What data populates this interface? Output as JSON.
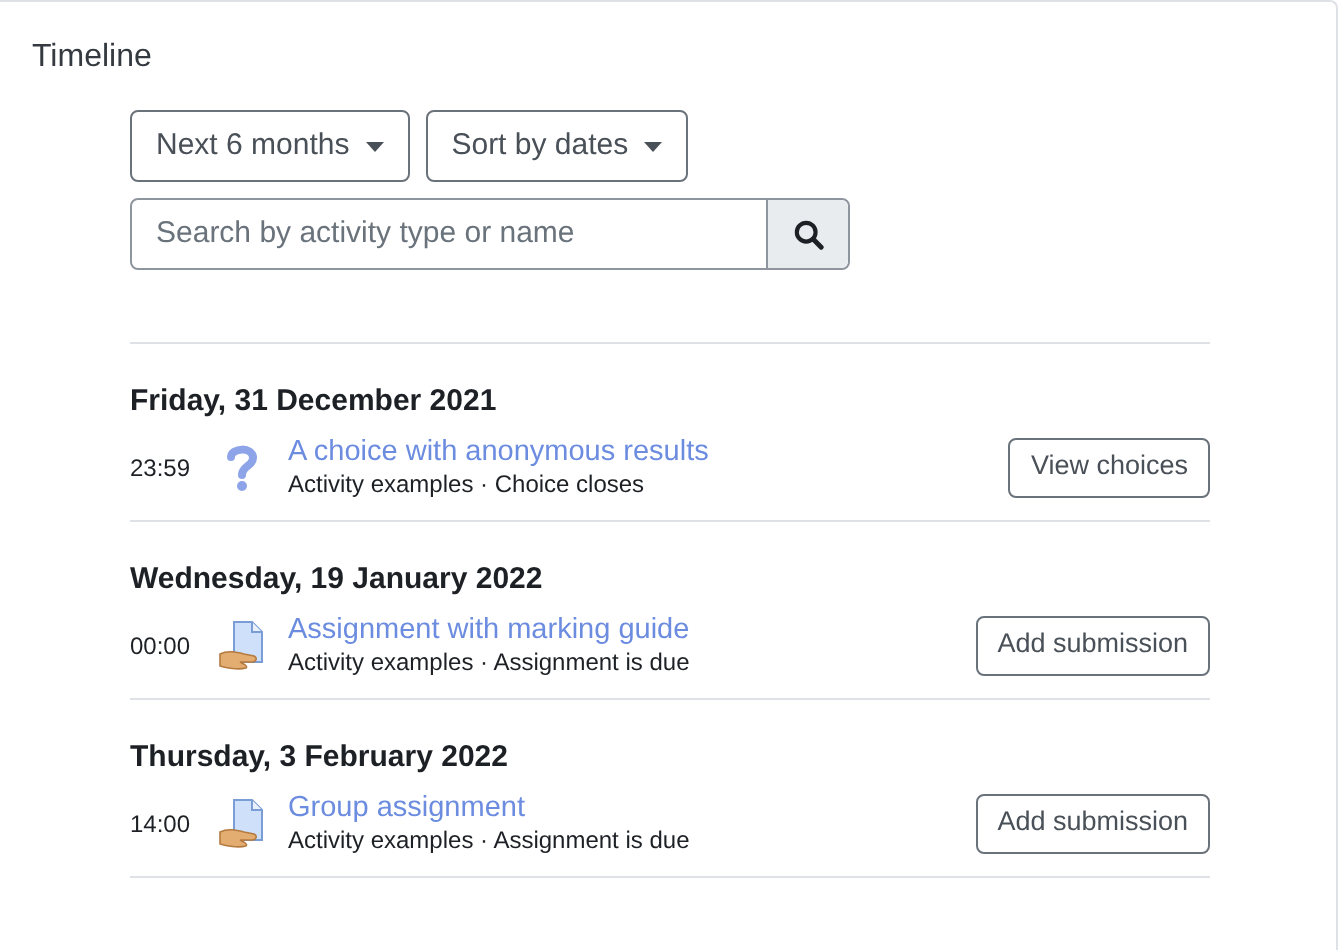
{
  "title": "Timeline",
  "filters": [
    {
      "label": "Next 6 months"
    },
    {
      "label": "Sort by dates"
    }
  ],
  "search": {
    "placeholder": "Search by activity type or name"
  },
  "days": [
    {
      "date": "Friday, 31 December 2021",
      "events": [
        {
          "time": "23:59",
          "kind": "choice",
          "name": "A choice with anonymous results",
          "details": "Activity examples · Choice closes",
          "button": "View choices"
        }
      ]
    },
    {
      "date": "Wednesday, 19 January 2022",
      "events": [
        {
          "time": "00:00",
          "kind": "assignment",
          "name": "Assignment with marking guide",
          "details": "Activity examples · Assignment is due",
          "button": "Add submission"
        }
      ]
    },
    {
      "date": "Thursday, 3 February 2022",
      "events": [
        {
          "time": "14:00",
          "kind": "assignment",
          "name": "Group assignment",
          "details": "Activity examples · Assignment is due",
          "button": "Add submission"
        }
      ]
    }
  ]
}
